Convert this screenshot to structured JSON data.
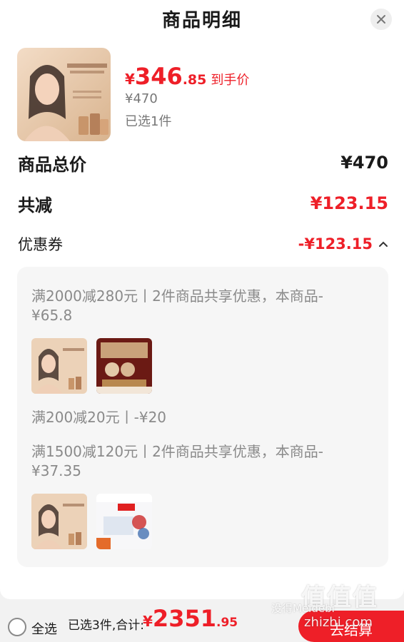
{
  "header": {
    "title": "商品明细",
    "close_icon": "close-icon"
  },
  "product": {
    "image_icon": "estee-lauder-dw-foundation-image",
    "price_symbol": "¥",
    "price_int": "346",
    "price_dec": ".85",
    "price_note": "到手价",
    "original_price": "¥470",
    "selected_count": "已选1件"
  },
  "summary": {
    "total_label": "商品总价",
    "total_value": "¥470",
    "reduce_label": "共减",
    "reduce_value": "¥123.15",
    "coupon_label": "优惠券",
    "coupon_value": "-¥123.15",
    "coupon_toggle_icon": "chevron-up-icon"
  },
  "coupons": {
    "c1_text": "满2000减280元丨2件商品共享优惠，本商品-¥65.8",
    "c2_text": "满200减20元丨-¥20",
    "c3_text": "满1500减120元丨2件商品共享优惠，本商品-¥37.35"
  },
  "footer": {
    "select_all_label": "全选",
    "selected_summary": "已选3件,合计:",
    "total_symbol": "¥",
    "total_int": "2351",
    "total_dec": ".95",
    "checkout_label": "去结算"
  },
  "watermark": {
    "big": "值值值",
    "small": "没得Meidebi",
    "url": "zhizhi.com"
  },
  "colors": {
    "accent": "#ee1f28",
    "muted": "#8a8a8a",
    "panel": "#f6f6f6"
  }
}
